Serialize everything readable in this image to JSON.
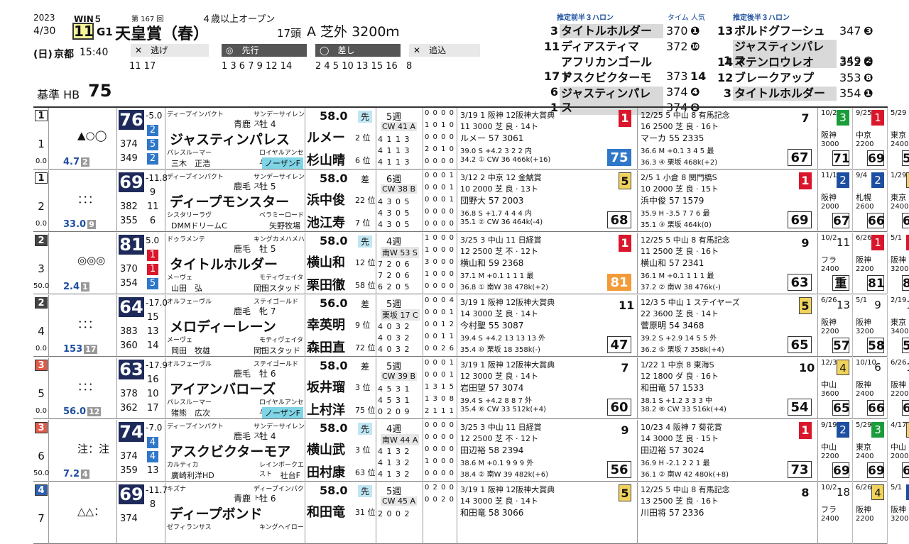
{
  "header": {
    "year": "2023",
    "date": "4/30",
    "day": "(日)",
    "venue": "京都",
    "time": "15:40",
    "win5": "WIN５",
    "kai": "第 167 回",
    "race_no": "11",
    "grade": "G1",
    "title": "天皇賞（春）",
    "cond": "４歳以上オープン",
    "heads": "17頭",
    "course": "A 芝外 3200ｍ",
    "hb_label": "基準 HB",
    "hb_value": "75",
    "styles": [
      {
        "label": "逃げ",
        "horses": "11 17"
      },
      {
        "label": "先行",
        "horses": "1 3 6 7 9 12 14"
      },
      {
        "label": "差し",
        "horses": "2 4 5 10 13 15 16"
      },
      {
        "label": "追込",
        "horses": "8"
      }
    ],
    "pred_front_label": "推定前半３ハロン",
    "pred_time_label": "タイム 人気",
    "pred_back_label": "推定後半３ハロン",
    "front": [
      {
        "no": "3",
        "name": "タイトルホルダー",
        "time": "370",
        "pop": "1"
      },
      {
        "no": "11",
        "name": "ディアスティマ",
        "time": "372",
        "pop": "10"
      },
      {
        "no": "17",
        "name": "アフリカンゴールド",
        "time": "373",
        "pop": "14"
      },
      {
        "no": "6",
        "name": "アスクビクターモア",
        "time": "374",
        "pop": "4"
      },
      {
        "no": "1",
        "name": "ジャスティンパレス",
        "time": "374",
        "pop": "2"
      }
    ],
    "back": [
      {
        "no": "13",
        "name": "ボルドグフーシュ",
        "time": "347",
        "pop": "3"
      },
      {
        "no": "1",
        "name": "ジャスティンパレス",
        "time": "349",
        "pop": "2"
      },
      {
        "no": "14",
        "name": "マテンロウレオ",
        "time": "352",
        "pop": "6"
      },
      {
        "no": "12",
        "name": "ブレークアップ",
        "time": "353",
        "pop": "8"
      },
      {
        "no": "3",
        "name": "タイトルホルダー",
        "time": "354",
        "pop": "1"
      }
    ]
  },
  "horses": [
    {
      "frame": "1",
      "no": "1",
      "marks": "▲○◯",
      "odds": "4.7",
      "pop": "2",
      "frame_odds": "0.0",
      "speed": "76",
      "diff": "-5.0",
      "rk1": "2",
      "rk2": "5",
      "rk3": "2",
      "l1": "374",
      "l2": "349",
      "sire": "ディープインパクト",
      "sire2": "サンデーサイレンス",
      "coat": "青鹿　牡 4",
      "name": "ジャスティンパレス",
      "dam": "パレスルーマー",
      "damsire": "ロイヤルアンセム",
      "owner": "三木　正浩",
      "breeder": "ノーザンF",
      "breeder_hl": true,
      "weight": "58.0",
      "style": "先",
      "j1": "ルメー",
      "j1p": "2 位",
      "j2": "杉山晴",
      "j2p": "6 位",
      "wk": "5週",
      "cw": "CW 41 A",
      "tr": [
        "4 1 1 3",
        "4 1 1 3",
        "4 1 1 3"
      ],
      "rec": [
        "0 0 0 0",
        "1 0 1 0",
        "0 0 0 0",
        "2 0 1 0",
        "0 0 0 0"
      ],
      "p1": {
        "l1": "3/19 1 阪神 12阪神大賞典",
        "l2": "11 3000 芝 良 · 14ト",
        "l3": "ルメー 57 3061",
        "l4": "39.0 S +4.2 3 2 2 内",
        "l5": "34.2 ① CW 36 466k(+16)",
        "fin": "1",
        "fc": "red",
        "fig": "75",
        "fgc": "blue"
      },
      "p2": {
        "l1": "12/25 5 中山 8 有馬記念",
        "l2": "16 2500 芝 良 · 16ト",
        "l3": "マーカ 55 2335",
        "l4": "36.6 M +0.1 3 4 5 最",
        "l5": "36.3 ④ 栗坂 468k(+2)",
        "fin": "7",
        "fc": "",
        "fig": "67",
        "fgc": ""
      },
      "m": [
        {
          "dt": "10/23",
          "fn": "3",
          "fc": "grn",
          "cr": "阪神",
          "ds": "3000",
          "fg": "71"
        },
        {
          "dt": "9/25",
          "fn": "1",
          "fc": "red",
          "cr": "中京",
          "ds": "2200",
          "fg": "69"
        },
        {
          "dt": "5/29",
          "fn": "9",
          "fc": "",
          "cr": "東京",
          "ds": "2400",
          "fg": "59"
        }
      ]
    },
    {
      "frame": "1",
      "no": "2",
      "marks": "：：：",
      "odds": "33.0",
      "pop": "9",
      "frame_odds": "0.0",
      "speed": "69",
      "diff": "-11.8",
      "rk1": "9",
      "rk2": "11",
      "rk3": "6",
      "l1": "382",
      "l2": "355",
      "sire": "ディープインパクト",
      "sire2": "サンデーサイレンス",
      "coat": "鹿毛　牡 5",
      "name": "ディープモンスター",
      "dam": "シスタリーラヴ",
      "damsire": "ベラミーロード",
      "owner": "DMMドリームC",
      "breeder": "矢野牧場",
      "breeder_hl": false,
      "weight": "58.0",
      "style": "差",
      "j1": "浜中俊",
      "j1p": "22 位",
      "j2": "池江寿",
      "j2p": "7 位",
      "wk": "6週",
      "cw": "CW 38 B",
      "tr": [
        "4 3 0 5",
        "4 3 0 5",
        "4 3 0 5"
      ],
      "rec": [
        "0 0 0 1",
        "0 0 0 1",
        "0 0 0 1",
        "0 0 0 0",
        "0 0 0 0"
      ],
      "p1": {
        "l1": "3/12 2 中京 12 金鯱賞",
        "l2": "10 2000 芝 良 · 13ト",
        "l3": "団野大 57 2003",
        "l4": "36.8 S +1.7 4 4 4 内",
        "l5": "35.1 ② CW 36 464k(-4)",
        "fin": "5",
        "fc": "ylw",
        "fig": "68",
        "fgc": ""
      },
      "p2": {
        "l1": "2/5 1 小倉 8 関門橋S",
        "l2": "10 2000 芝 良 · 15ト",
        "l3": "浜中俊 57 1579",
        "l4": "35.9 H -3.5 7 7 6 最",
        "l5": "35.1 ③ 栗坂 464k(0)",
        "fin": "1",
        "fc": "red",
        "fig": "69",
        "fgc": ""
      },
      "m": [
        {
          "dt": "11/19",
          "fn": "2",
          "fc": "blue",
          "cr": "阪神",
          "ds": "2000",
          "fg": "67"
        },
        {
          "dt": "9/4",
          "fn": "2",
          "fc": "blue",
          "cr": "札幌",
          "ds": "2600",
          "fg": "66"
        },
        {
          "dt": "1/29",
          "fn": "5",
          "fc": "ylw",
          "cr": "東京",
          "ds": "2400",
          "fg": "65"
        }
      ]
    },
    {
      "frame": "2",
      "no": "3",
      "marks": "◎◎◎",
      "odds": "2.4",
      "pop": "1",
      "frame_odds": "50.0",
      "speed": "81",
      "diff": "5.0",
      "rk1": "1",
      "rk2": "1",
      "rk3": "5",
      "l1": "370",
      "l2": "354",
      "sire": "ドゥラメンテ",
      "sire2": "キングカメハメハ",
      "coat": "鹿毛　牡 5",
      "name": "タイトルホルダー",
      "dam": "メーヴェ",
      "damsire": "モティヴェイター",
      "owner": "山田　弘",
      "breeder": "岡田スタッド",
      "breeder_hl": false,
      "weight": "58.0",
      "style": "先",
      "j1": "横山和",
      "j1p": "12 位",
      "j2": "栗田徹",
      "j2p": "58 位",
      "wk": "4週",
      "cw": "南W 53 S",
      "tr": [
        "7 2 0 6",
        "7 2 0 6",
        "6 2 0 5"
      ],
      "rec": [
        "1 0 0 0",
        "1 0 0 0",
        "3 0 0 0",
        "1 0 0 0",
        "0 0 0 0"
      ],
      "p1": {
        "l1": "3/25 3 中山 11 日経賞",
        "l2": "12 2500 芝 不 · 12ト",
        "l3": "横山和 59 2368",
        "l4": "37.1 M +0.1 1 1 1 最",
        "l5": "36.8 ① 南W 38 478k(+2)",
        "fin": "1",
        "fc": "red",
        "fig": "81",
        "fgc": "org"
      },
      "p2": {
        "l1": "12/25 5 中山 8 有馬記念",
        "l2": "11 2500 芝 良 · 16ト",
        "l3": "横山和 57 2341",
        "l4": "36.1 M +0.1 1 1 1 最",
        "l5": "37.2 ② 南W 38 476k(-)",
        "fin": "9",
        "fc": "",
        "fig": "63",
        "fgc": ""
      },
      "m": [
        {
          "dt": "10/2",
          "fn": "11",
          "fc": "",
          "cr": "フラ",
          "ds": "2400",
          "fg": "重"
        },
        {
          "dt": "6/26",
          "fn": "1",
          "fc": "red",
          "cr": "阪神",
          "ds": "2200",
          "fg": "81"
        },
        {
          "dt": "5/1",
          "fn": "1",
          "fc": "red",
          "cr": "阪神",
          "ds": "3200",
          "fg": "81"
        }
      ]
    },
    {
      "frame": "2",
      "no": "4",
      "marks": "：：：",
      "odds": "153",
      "pop": "17",
      "frame_odds": "0.0",
      "speed": "64",
      "diff": "-17.0",
      "rk1": "15",
      "rk2": "13",
      "rk3": "14",
      "l1": "383",
      "l2": "360",
      "sire": "オルフェーヴル",
      "sire2": "ステイゴールド",
      "coat": "鹿毛　牝 7",
      "name": "メロディーレーン",
      "dam": "メーヴェ",
      "damsire": "モティヴェイター",
      "owner": "岡田　牧雄",
      "breeder": "岡田スタッド",
      "breeder_hl": false,
      "weight": "56.0",
      "style": "差",
      "j1": "幸英明",
      "j1p": "9 位",
      "j2": "森田直",
      "j2p": "72 位",
      "wk": "5週",
      "cw": "栗坂 17 C",
      "tr": [
        "4 0 3 2",
        "4 0 3 2",
        "4 0 3 2"
      ],
      "rec": [
        "0 0 0 4",
        "0 0 0 1",
        "0 0 1 2",
        "0 0 1 1",
        "0 0 2 6"
      ],
      "p1": {
        "l1": "3/19 1 阪神 12阪神大賞典",
        "l2": "14 3000 芝 良 · 14ト",
        "l3": "今村聖 55 3087",
        "l4": "39.4 S +4.2 13 13 13 外",
        "l5": "35.4 ⑩ 栗坂 18 358k(-)",
        "fin": "11",
        "fc": "",
        "fig": "47",
        "fgc": ""
      },
      "p2": {
        "l1": "12/3 5 中山 1 ステイヤーズ",
        "l2": "22 3600 芝 良 · 14ト",
        "l3": "菅原明 54 3468",
        "l4": "39.2 S +2.9 14 5 5 外",
        "l5": "36.2 ⑤ 栗坂 7 358k(+4)",
        "fin": "5",
        "fc": "ylw",
        "fig": "65",
        "fgc": ""
      },
      "m": [
        {
          "dt": "6/26",
          "fn": "13",
          "fc": "",
          "cr": "阪神",
          "ds": "2200",
          "fg": "57"
        },
        {
          "dt": "5/1",
          "fn": "9",
          "fc": "",
          "cr": "阪神",
          "ds": "3200",
          "fg": "58"
        },
        {
          "dt": "2/19",
          "fn": "13",
          "fc": "",
          "cr": "東京",
          "ds": "3400",
          "fg": "58"
        }
      ]
    },
    {
      "frame": "3",
      "no": "5",
      "marks": "：：：",
      "odds": "56.0",
      "pop": "12",
      "frame_odds": "0.0",
      "speed": "63",
      "diff": "-17.9",
      "rk1": "16",
      "rk2": "10",
      "rk3": "17",
      "l1": "378",
      "l2": "362",
      "sire": "オルフェーヴル",
      "sire2": "ステイゴールド",
      "coat": "鹿毛　牡 6",
      "name": "アイアンバローズ",
      "dam": "パレスルーマー",
      "damsire": "ロイヤルアンセム",
      "owner": "猪熊　広次",
      "breeder": "ノーザンF",
      "breeder_hl": true,
      "weight": "58.0",
      "style": "差",
      "j1": "坂井瑠",
      "j1p": "3 位",
      "j2": "上村洋",
      "j2p": "75 位",
      "wk": "5週",
      "cw": "CW 39 B",
      "tr": [
        "4 5 3 1",
        "4 5 3 1",
        "0 2 0 9"
      ],
      "rec": [
        "0 0 0 1",
        "0 0 0 1",
        "1 3 1 5",
        "1 3 0 8",
        "2 1 1 1"
      ],
      "p1": {
        "l1": "3/19 1 阪神 12阪神大賞典",
        "l2": "12 3000 芝 良 · 14ト",
        "l3": "岩田望 57 3074",
        "l4": "39.4 S +4.2 8 8 7 外",
        "l5": "35.4 ⑥ CW 33 512k(+4)",
        "fin": "7",
        "fc": "",
        "fig": "60",
        "fgc": ""
      },
      "p2": {
        "l1": "1/22 1 中京 8 東海S",
        "l2": "12 1800 ダ 良 · 16ト",
        "l3": "和田竜 57 1533",
        "l4": "38.1 S +1.2 3 3 3 中",
        "l5": "38.2 ⑧ CW 33 516k(+4)",
        "fin": "10",
        "fc": "",
        "fig": "54",
        "fgc": ""
      },
      "m": [
        {
          "dt": "12/3",
          "fn": "4",
          "fc": "ylw",
          "cr": "中山",
          "ds": "3600",
          "fg": "65"
        },
        {
          "dt": "10/10",
          "fn": "6",
          "fc": "",
          "cr": "阪神",
          "ds": "2400",
          "fg": "66"
        },
        {
          "dt": "6/26",
          "fn": "15",
          "fc": "",
          "cr": "阪神",
          "ds": "2200",
          "fg": "65"
        }
      ]
    },
    {
      "frame": "3",
      "no": "6",
      "marks": "注：注",
      "odds": "7.2",
      "pop": "4",
      "frame_odds": "50.0",
      "speed": "74",
      "diff": "-7.0",
      "rk1": "4",
      "rk2": "4",
      "rk3": "13",
      "l1": "374",
      "l2": "359",
      "sire": "ディープインパクト",
      "sire2": "サンデーサイレンス",
      "coat": "鹿毛　牡 4",
      "name": "アスクビクターモア",
      "dam": "カルティカ",
      "damsire": "レインボークエスト",
      "owner": "廣崎利洋HD",
      "breeder": "社台F",
      "breeder_hl": false,
      "weight": "58.0",
      "style": "先",
      "j1": "横山武",
      "j1p": "3 位",
      "j2": "田村康",
      "j2p": "63 位",
      "wk": "4週",
      "cw": "南W 44 A",
      "tr": [
        "4 1 3 2",
        "4 1 3 2",
        "4 1 3 2"
      ],
      "rec": [
        "0 0 0 0",
        "0 0 0 0",
        "0 0 0 0",
        "1 0 0 0",
        "0 0 0 0"
      ],
      "p1": {
        "l1": "3/25 3 中山 11 日経賞",
        "l2": "12 2500 芝 不 · 12ト",
        "l3": "田辺裕 58 2394",
        "l4": "38.6 M +0.1 9 9 9 外",
        "l5": "38.4 ② 南W 39 482k(+6)",
        "fin": "9",
        "fc": "",
        "fig": "56",
        "fgc": ""
      },
      "p2": {
        "l1": "10/23 4 阪神 7 菊花賞",
        "l2": "14 3000 芝 良 · 15ト",
        "l3": "田辺裕 57 3024",
        "l4": "36.9 H -2.1 2 2 1 最",
        "l5": "36.1 ② 南W 42 480k(+8)",
        "fin": "1",
        "fc": "red",
        "fig": "73",
        "fgc": ""
      },
      "m": [
        {
          "dt": "9/19",
          "fn": "2",
          "fc": "blue",
          "cr": "中山",
          "ds": "2200",
          "fg": "69"
        },
        {
          "dt": "5/29",
          "fn": "3",
          "fc": "grn",
          "cr": "東京",
          "ds": "2400",
          "fg": "69"
        },
        {
          "dt": "4/17",
          "fn": "5",
          "fc": "ylw",
          "cr": "中山",
          "ds": "2000",
          "fg": "65"
        }
      ]
    },
    {
      "frame": "4",
      "no": "7",
      "marks": "△△：",
      "odds": "",
      "pop": "",
      "frame_odds": "",
      "speed": "69",
      "diff": "-11.7",
      "rk1": "8",
      "rk2": "",
      "rk3": "",
      "l1": "374",
      "l2": "",
      "sire": "キズナ",
      "sire2": "ディープインパクト",
      "coat": "青鹿　牡 6",
      "name": "ディープボンド",
      "dam": "ゼフィランサス",
      "damsire": "キングヘイロー",
      "owner": "",
      "breeder": "",
      "breeder_hl": false,
      "weight": "58.0",
      "style": "先",
      "j1": "和田竜",
      "j1p": "31 位",
      "j2": "",
      "j2p": "",
      "wk": "5週",
      "cw": "CW 45 A",
      "tr": [
        "2 0 0 2",
        "",
        ""
      ],
      "rec": [
        "0 2 0 0",
        "0 0 2 0",
        "",
        "",
        ""
      ],
      "p1": {
        "l1": "3/19 1 阪神 12阪神大賞典",
        "l2": "14 3000 芝 良 · 14ト",
        "l3": "和田竜 58 3066",
        "l4": "",
        "l5": "",
        "fin": "5",
        "fc": "ylw",
        "fig": "",
        "fgc": ""
      },
      "p2": {
        "l1": "12/25 5 中山 8 有馬記念",
        "l2": "13 2500 芝 良 · 16ト",
        "l3": "川田将 57 2336",
        "l4": "",
        "l5": "",
        "fin": "8",
        "fc": "",
        "fig": "",
        "fgc": ""
      },
      "m": [
        {
          "dt": "10/2",
          "fn": "18",
          "fc": "",
          "cr": "フラ",
          "ds": "2400",
          "fg": ""
        },
        {
          "dt": "6/26",
          "fn": "4",
          "fc": "ylw",
          "cr": "阪神",
          "ds": "2200",
          "fg": ""
        },
        {
          "dt": "5/1",
          "fn": "2",
          "fc": "blue",
          "cr": "阪神",
          "ds": "3200",
          "fg": ""
        }
      ]
    }
  ],
  "colors": {
    "frame1": "#ffffff",
    "frame2": "#333333",
    "frame3": "#e05a4a",
    "frame4": "#2f5fb0",
    "speed_bg": "#1e2a5a",
    "breeder_hl": "#7fd4e6"
  }
}
